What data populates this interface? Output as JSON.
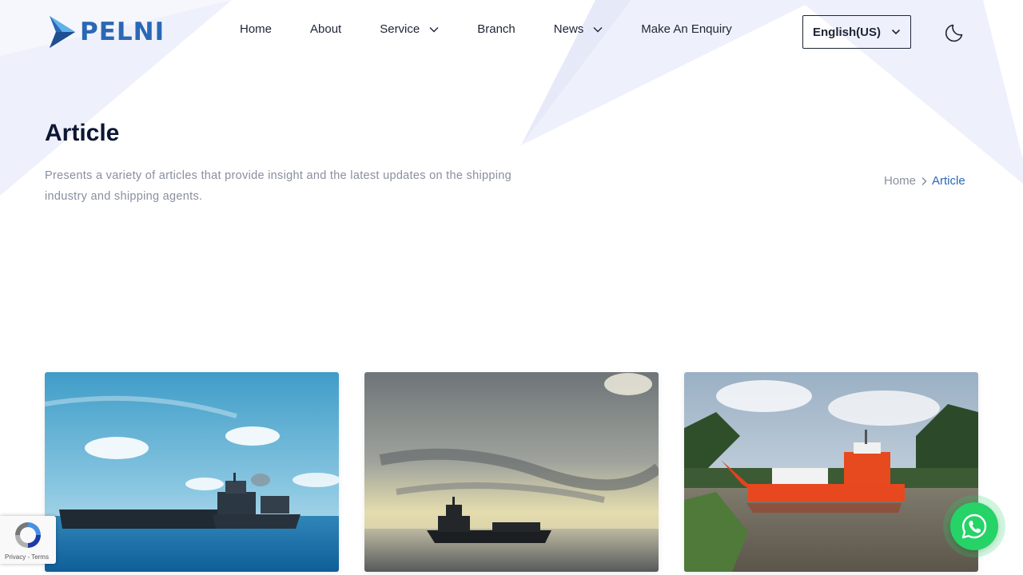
{
  "brand": {
    "name": "PELNI",
    "color": "#2a68b5"
  },
  "nav": {
    "items": [
      {
        "label": "Home",
        "has_dropdown": false
      },
      {
        "label": "About",
        "has_dropdown": false
      },
      {
        "label": "Service",
        "has_dropdown": true
      },
      {
        "label": "Branch",
        "has_dropdown": false
      },
      {
        "label": "News",
        "has_dropdown": true
      },
      {
        "label": "Make An Enquiry",
        "has_dropdown": false
      }
    ]
  },
  "language": {
    "selected": "English(US)"
  },
  "theme_toggle": {
    "icon": "moon-icon"
  },
  "hero": {
    "title": "Article",
    "description": "Presents a variety of articles that provide insight and the latest updates on the shipping industry and shipping agents."
  },
  "breadcrumb": {
    "home": "Home",
    "current": "Article"
  },
  "articles": [
    {
      "image": "tugboat-and-barge-at-sea"
    },
    {
      "image": "ship-silhouette-at-sunset"
    },
    {
      "image": "red-landing-craft-on-river"
    }
  ],
  "recaptcha": {
    "text": "Privacy - Terms"
  },
  "whatsapp": {
    "icon": "whatsapp-icon",
    "color": "#25d366"
  },
  "colors": {
    "heading": "#0d1633",
    "muted": "#8a8fa0",
    "accent": "#2a68b5",
    "decor": "#eef1fb"
  }
}
